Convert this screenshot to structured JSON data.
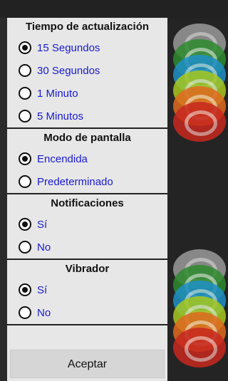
{
  "sections": [
    {
      "title": "Tiempo de actualización",
      "options": [
        {
          "label": "15 Segundos",
          "selected": true
        },
        {
          "label": "30 Segundos",
          "selected": false
        },
        {
          "label": "1 Minuto",
          "selected": false
        },
        {
          "label": "5 Minutos",
          "selected": false
        }
      ]
    },
    {
      "title": "Modo de pantalla",
      "options": [
        {
          "label": "Encendida",
          "selected": true
        },
        {
          "label": "Predeterminado",
          "selected": false
        }
      ]
    },
    {
      "title": "Notificaciones",
      "options": [
        {
          "label": "Sí",
          "selected": true
        },
        {
          "label": "No",
          "selected": false
        }
      ]
    },
    {
      "title": "Vibrador",
      "options": [
        {
          "label": "Sí",
          "selected": true
        },
        {
          "label": "No",
          "selected": false
        }
      ]
    }
  ],
  "buttons": {
    "accept_label": "Aceptar"
  },
  "colors": {
    "option_text": "#1a1ad0",
    "ring_colors": [
      "#9a9a9a",
      "#2e8b2e",
      "#1e90c8",
      "#a8c81e",
      "#e06a1e",
      "#c8281e"
    ]
  }
}
